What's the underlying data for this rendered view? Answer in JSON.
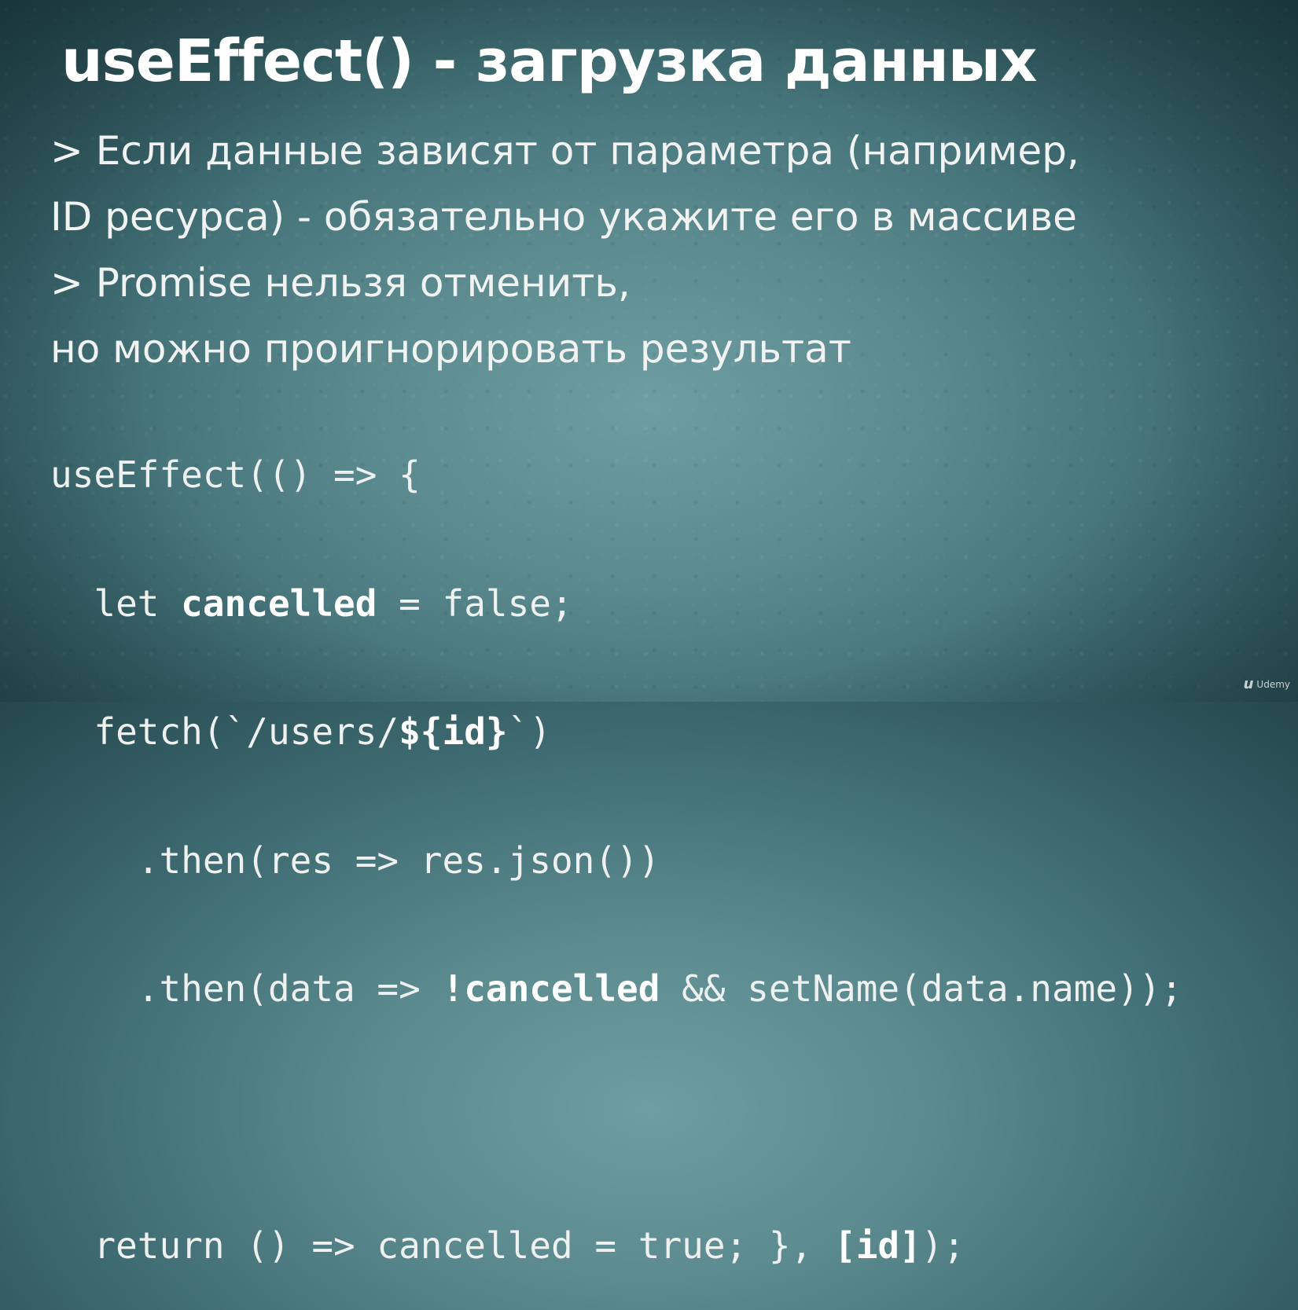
{
  "slide": {
    "title": "useEffect() - загрузка данных",
    "bullets": [
      "> Если данные зависят от параметра (например,",
      "ID ресурса) - обязательно укажите его в массиве",
      "> Promise нельзя отменить,",
      "но можно проигнорировать результат"
    ],
    "code": {
      "line1": "useEffect(() => {",
      "line2_pre": "  let ",
      "line2_bold": "cancelled",
      "line2_post": " = false;",
      "line3_pre": "  fetch(`/users/",
      "line3_bold": "${id}",
      "line3_post": "`)",
      "line4": "    .then(res => res.json())",
      "line5_pre": "    .then(data => ",
      "line5_bold": "!cancelled",
      "line5_post": " && setName(data.name));",
      "line7_pre": "  return () => cancelled = true; }, ",
      "line7_bold": "[id]",
      "line7_post": ");"
    }
  },
  "watermark": {
    "mark": "u",
    "text": "Udemy"
  }
}
